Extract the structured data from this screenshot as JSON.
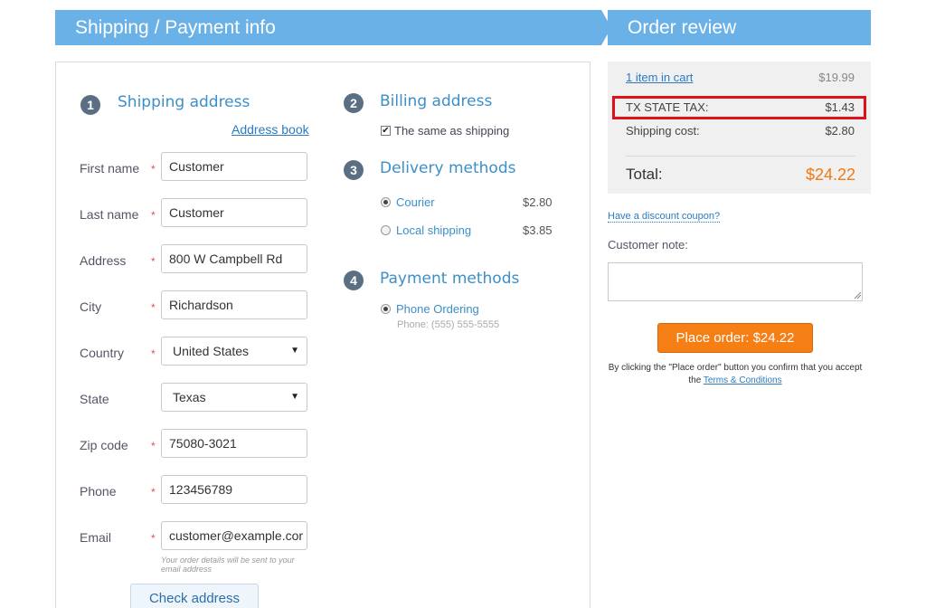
{
  "header": {
    "left_title": "Shipping / Payment info",
    "right_title": "Order review"
  },
  "shipping": {
    "step": "1",
    "title": "Shipping address",
    "address_book_link": "Address book",
    "fields": {
      "first_name": {
        "label": "First name",
        "value": "Customer",
        "required": true
      },
      "last_name": {
        "label": "Last name",
        "value": "Customer",
        "required": true
      },
      "address": {
        "label": "Address",
        "value": "800 W Campbell Rd",
        "required": true
      },
      "city": {
        "label": "City",
        "value": "Richardson",
        "required": true
      },
      "country": {
        "label": "Country",
        "value": "United States",
        "required": true
      },
      "state": {
        "label": "State",
        "value": "Texas",
        "required": false
      },
      "zip": {
        "label": "Zip code",
        "value": "75080-3021",
        "required": true
      },
      "phone": {
        "label": "Phone",
        "value": "123456789",
        "required": true
      },
      "email": {
        "label": "Email",
        "value": "customer@example.cor",
        "required": true
      }
    },
    "required_mark": "*",
    "email_hint": "Your order details will be sent to your email address",
    "check_address_button": "Check address"
  },
  "billing": {
    "step": "2",
    "title": "Billing address",
    "same_as_shipping_label": "The same as shipping",
    "same_as_shipping_checked": true
  },
  "delivery": {
    "step": "3",
    "title": "Delivery methods",
    "options": [
      {
        "label": "Courier",
        "price": "$2.80",
        "selected": true
      },
      {
        "label": "Local shipping",
        "price": "$3.85",
        "selected": false
      }
    ]
  },
  "payment": {
    "step": "4",
    "title": "Payment methods",
    "options": [
      {
        "label": "Phone Ordering",
        "detail": "Phone: (555) 555-5555",
        "selected": true
      }
    ]
  },
  "review": {
    "cart_link": "1 item in cart",
    "cart_total": "$19.99",
    "tax_label": "TX STATE TAX:",
    "tax_value": "$1.43",
    "shipping_label": "Shipping cost:",
    "shipping_value": "$2.80",
    "total_label": "Total:",
    "total_value": "$24.22",
    "coupon_link": "Have a discount coupon?",
    "note_label": "Customer note:",
    "note_value": "",
    "place_order_button": "Place order: $24.22",
    "terms_prefix": "By clicking the \"Place order\" button you confirm that you accept the",
    "terms_link": "Terms & Conditions"
  },
  "colors": {
    "header_blue": "#6ab1e8",
    "accent_orange": "#f57f14",
    "link_blue": "#2c7bc0",
    "highlight_red": "#e0101a"
  },
  "icons": {
    "header_divider": "chevron-right-icon",
    "select_arrow": "triangle-down-icon",
    "textarea_resize": "resize-grip-icon"
  }
}
